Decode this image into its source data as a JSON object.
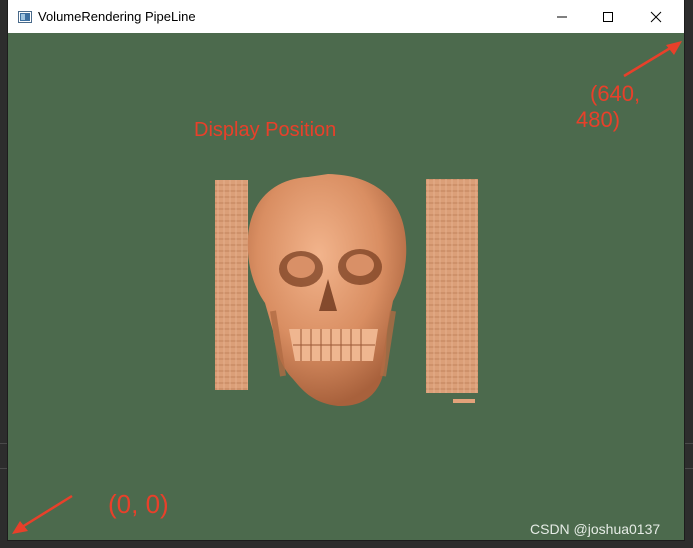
{
  "window": {
    "title": "VolumeRendering PipeLine",
    "icon": "app-window-icon",
    "background_color": "#4c6a4d",
    "controls": {
      "minimize_icon": "minimize-icon",
      "maximize_icon": "maximize-icon",
      "close_icon": "close-icon"
    }
  },
  "annotations": {
    "display_position_label": "Display Position",
    "top_right_coord_line1": "(640,",
    "top_right_coord_line2": "480)",
    "bottom_left_coord": "(0,  0)",
    "annotation_color": "#e8402a"
  },
  "scene": {
    "subject": "skull-volume-render",
    "render_color": "#e3a27a"
  },
  "watermark": {
    "text": "CSDN @joshua0137"
  }
}
